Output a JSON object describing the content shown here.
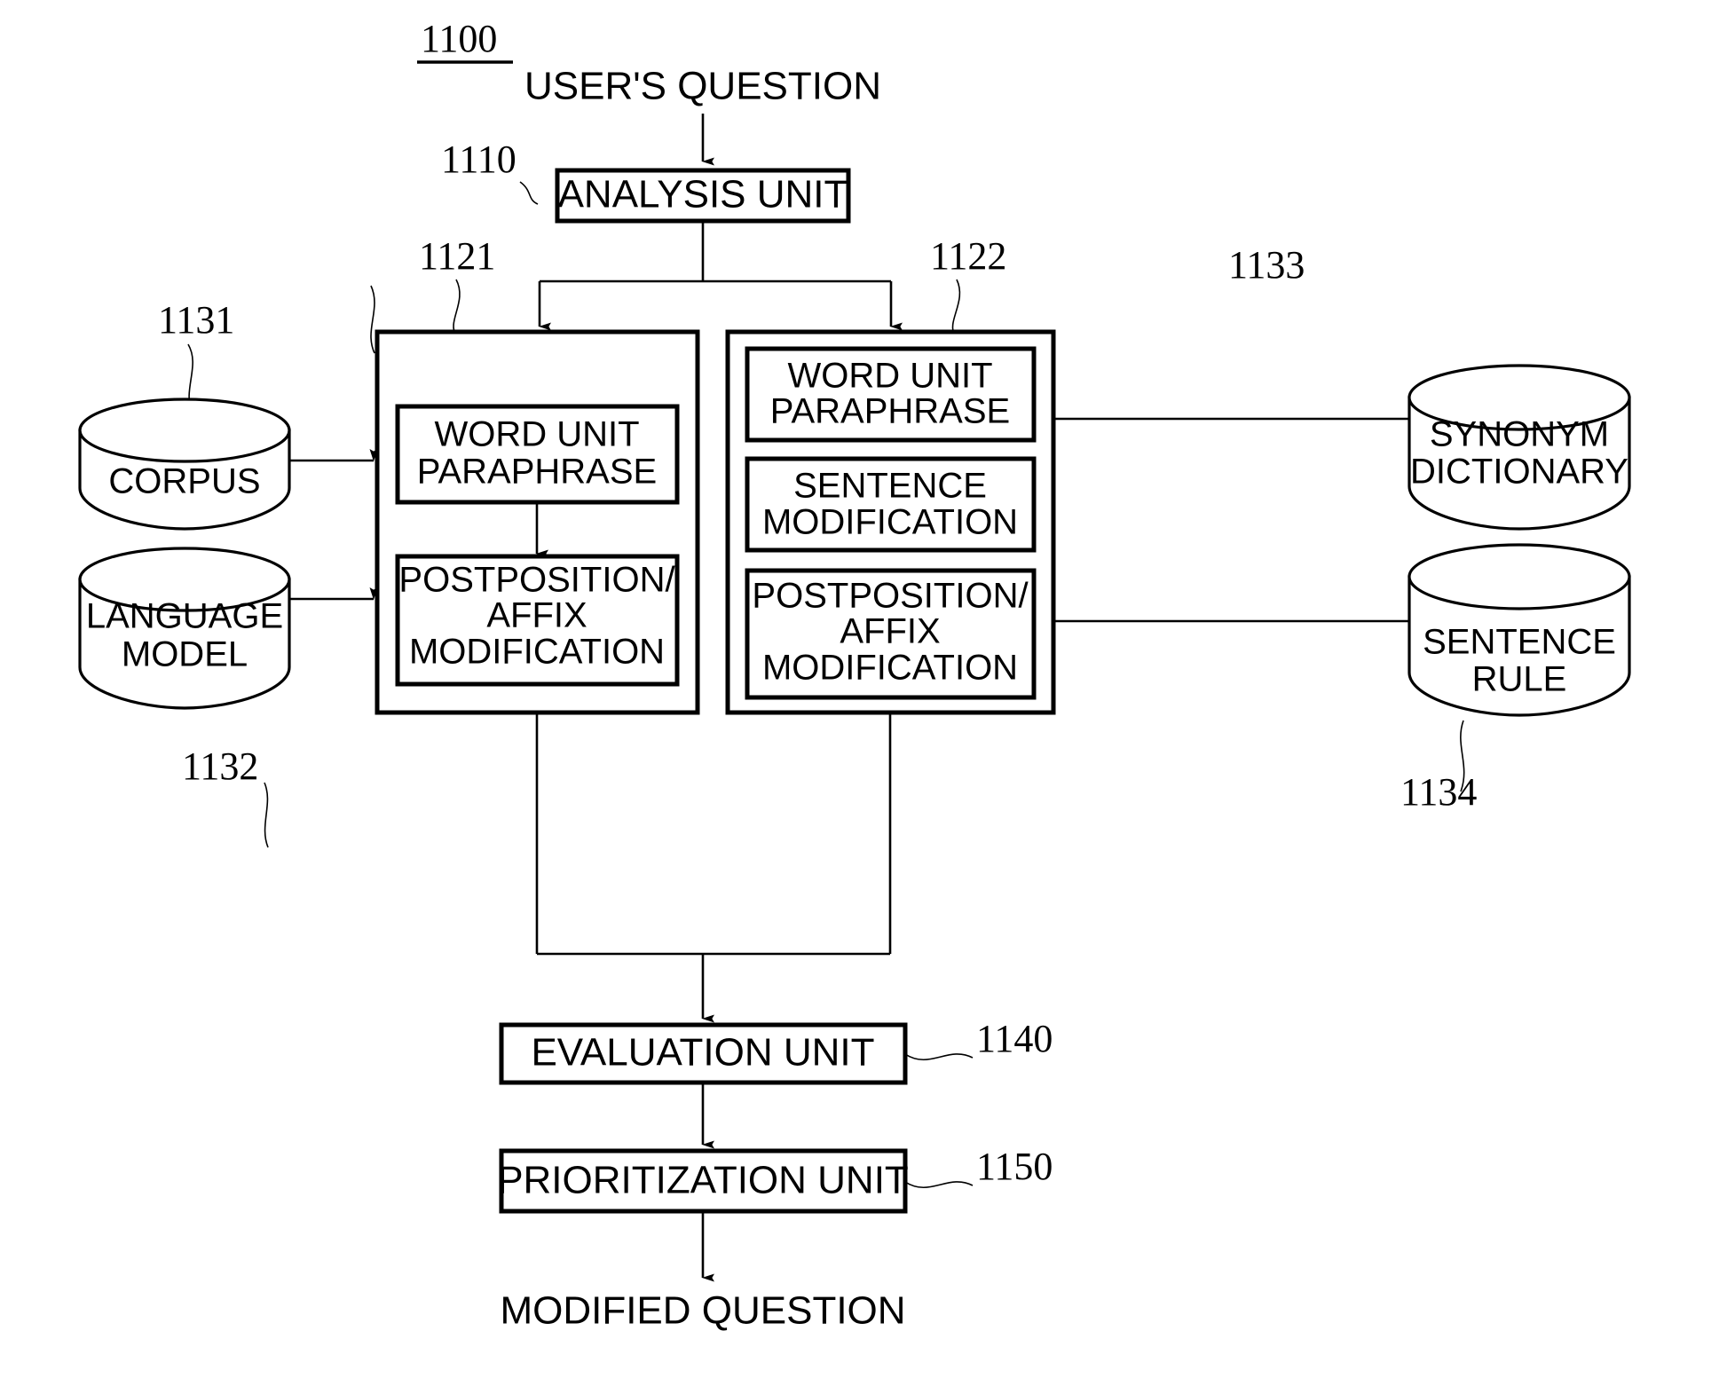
{
  "figure": {
    "figure_number": "1100",
    "input_label": "USER'S QUESTION",
    "output_label": "MODIFIED QUESTION"
  },
  "nodes": {
    "analysis_unit": {
      "label": "ANALYSIS UNIT",
      "ref": "1110"
    },
    "word_unit_branch": {
      "ref": "1121",
      "steps": [
        {
          "label_line1": "WORD UNIT",
          "label_line2": "PARAPHRASE"
        },
        {
          "label_line1": "POSTPOSITION/",
          "label_line2": "AFFIX",
          "label_line3": "MODIFICATION"
        }
      ]
    },
    "sentence_unit_branch": {
      "ref": "1122",
      "steps": [
        {
          "label_line1": "WORD UNIT",
          "label_line2": "PARAPHRASE"
        },
        {
          "label_line1": "SENTENCE",
          "label_line2": "MODIFICATION"
        },
        {
          "label_line1": "POSTPOSITION/",
          "label_line2": "AFFIX",
          "label_line3": "MODIFICATION"
        }
      ]
    },
    "evaluation_unit": {
      "label": "EVALUATION UNIT",
      "ref": "1140"
    },
    "prioritization_unit": {
      "label": "PRIORITIZATION UNIT",
      "ref": "1150"
    }
  },
  "databases": {
    "corpus": {
      "label_line1": "CORPUS",
      "label_line2": "",
      "ref": "1131"
    },
    "language_model": {
      "label_line1": "LANGUAGE",
      "label_line2": "MODEL",
      "ref": "1132"
    },
    "synonym_dictionary": {
      "label_line1": "SYNONYM",
      "label_line2": "DICTIONARY",
      "ref": "1133"
    },
    "sentence_rule": {
      "label_line1": "SENTENCE",
      "label_line2": "RULE",
      "ref": "1134"
    }
  },
  "colors": {
    "line": "#000000",
    "background": "#ffffff"
  }
}
